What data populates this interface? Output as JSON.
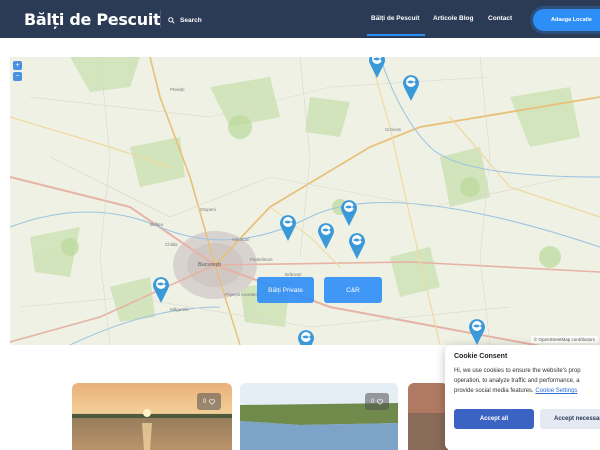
{
  "header": {
    "logo": "Bălți de Pescuit",
    "search_label": "Search",
    "nav": [
      "Bălți de Pescuit",
      "Articole Blog",
      "Contact"
    ],
    "cta_label": "Adauga Locatie"
  },
  "map": {
    "zoom_in": "+",
    "zoom_out": "−",
    "city_labels": [
      "București",
      "Urziceni",
      "Ploiești",
      "Buftea",
      "Otopeni",
      "Voluntari",
      "Pantelimon",
      "Popești-Leordeni",
      "Măgurele",
      "Chitila",
      "Brănești"
    ],
    "buttons": [
      "Bălți Private",
      "C&R"
    ],
    "attribution": "© OpenStreetMap contributors"
  },
  "cards": [
    {
      "count": "0",
      "badge_icon": "heart-icon"
    },
    {
      "count": "0",
      "badge_icon": "heart-icon"
    }
  ],
  "cookie": {
    "title": "Cookie Consent",
    "line1": "Hi, we use cookies to ensure the website's prop",
    "line2": "operation, to analyze traffic and performance, a",
    "line3_prefix": "provide social media features.",
    "link": "Cookie Settings",
    "accept_all": "Accept all",
    "accept_necessary": "Accept necessary"
  },
  "colors": {
    "header_bg": "#2b3a55",
    "accent": "#2e8ef7",
    "pin": "#3a9ad9"
  }
}
